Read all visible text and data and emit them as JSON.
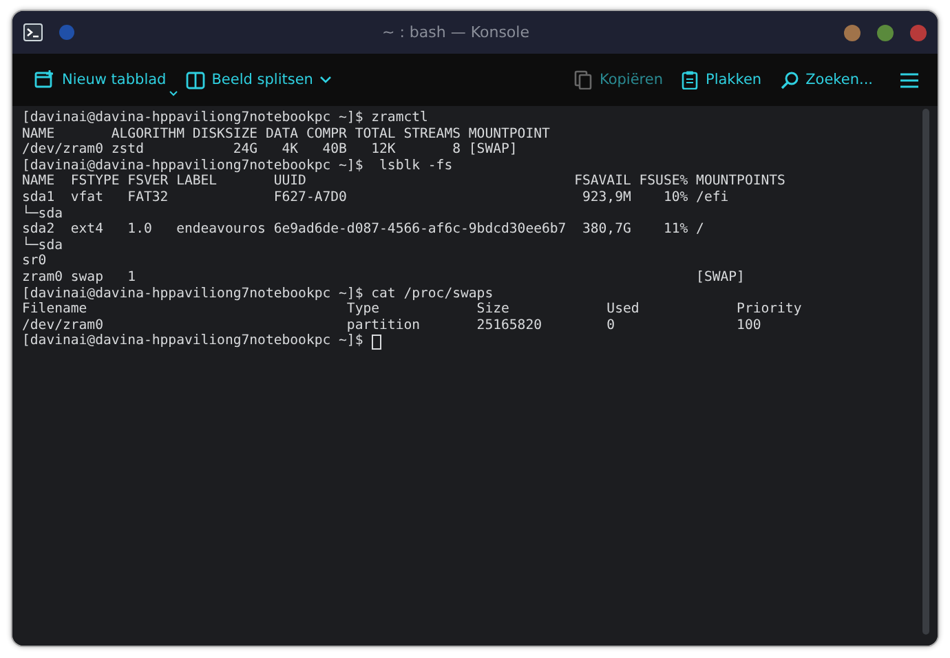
{
  "window": {
    "title": "~ : bash — Konsole"
  },
  "toolbar": {
    "left": [
      {
        "label": "Nieuw tabblad",
        "kind": "newtab",
        "disabled": false
      },
      {
        "label": "Beeld splitsen",
        "kind": "split",
        "disabled": false
      }
    ],
    "right": [
      {
        "label": "Kopiëren",
        "kind": "copy",
        "disabled": true
      },
      {
        "label": "Plakken",
        "kind": "paste",
        "disabled": false
      },
      {
        "label": "Zoeken...",
        "kind": "search",
        "disabled": false
      }
    ]
  },
  "terminal": {
    "lines": [
      "[davinai@davina-hppaviliong7notebookpc ~]$ zramctl",
      "NAME       ALGORITHM DISKSIZE DATA COMPR TOTAL STREAMS MOUNTPOINT",
      "/dev/zram0 zstd           24G   4K   40B   12K       8 [SWAP]",
      "[davinai@davina-hppaviliong7notebookpc ~]$  lsblk -fs",
      "NAME  FSTYPE FSVER LABEL       UUID                                 FSAVAIL FSUSE% MOUNTPOINTS",
      "sda1  vfat   FAT32             F627-A7D0                             923,9M    10% /efi",
      "└─sda",
      "sda2  ext4   1.0   endeavouros 6e9ad6de-d087-4566-af6c-9bdcd30ee6b7  380,7G    11% /",
      "└─sda",
      "sr0",
      "zram0 swap   1                                                                     [SWAP]",
      "[davinai@davina-hppaviliong7notebookpc ~]$ cat /proc/swaps",
      "Filename                                Type            Size            Used            Priority",
      "/dev/zram0                              partition       25165820        0               100"
    ],
    "prompt": "[davinai@davina-hppaviliong7notebookpc ~]$"
  }
}
